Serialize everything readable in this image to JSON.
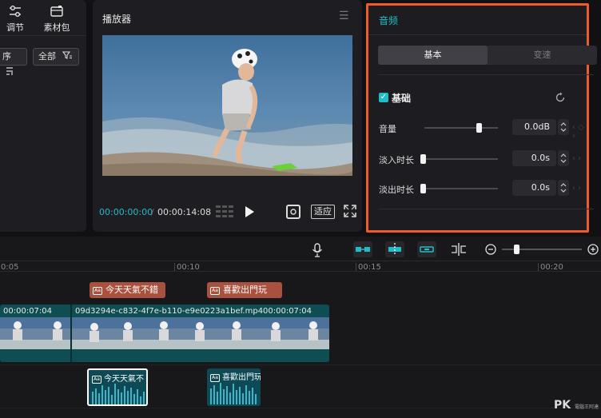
{
  "left_panel": {
    "tools": [
      {
        "label": "调节",
        "icon": "sliders-icon"
      },
      {
        "label": "素材包",
        "icon": "package-icon"
      }
    ],
    "sort_label": "序",
    "filter_label": "全部"
  },
  "player": {
    "title": "播放器",
    "time_current": "00:00:00:00",
    "time_separator": "/",
    "time_total": "00:00:14:08",
    "fit_label": "适应"
  },
  "audio_panel": {
    "title": "音频",
    "tabs": [
      {
        "label": "基本"
      },
      {
        "label": "变速"
      }
    ],
    "section_label": "基础",
    "rows": [
      {
        "label": "音量",
        "value": "0.0dB"
      },
      {
        "label": "淡入时长",
        "value": "0.0s"
      },
      {
        "label": "淡出时长",
        "value": "0.0s"
      }
    ]
  },
  "timeline": {
    "ruler": [
      {
        "label": "0:05"
      },
      {
        "label": "00:10"
      },
      {
        "label": "00:15"
      },
      {
        "label": "00:20"
      }
    ],
    "text_clips": [
      {
        "label": "今天天氣不錯"
      },
      {
        "label": "喜歡出門玩"
      }
    ],
    "video_clips": [
      {
        "label": "00:00:07:04"
      },
      {
        "label": "09d3294e-c832-4f7e-b110-e9e0223a1bef.mp4"
      },
      {
        "label": "00:00:07:04"
      }
    ],
    "audio_clips": [
      {
        "label": "今天天氣不"
      },
      {
        "label": "喜歡出門玩"
      }
    ],
    "tag_text": "Aa"
  },
  "watermark": {
    "text": "PK",
    "sub": "電腦王阿達"
  },
  "colors": {
    "accent": "#22bcc7",
    "highlight_border": "#ee5b2c",
    "text_clip": "#a9503e",
    "track": "#0e4d52"
  }
}
